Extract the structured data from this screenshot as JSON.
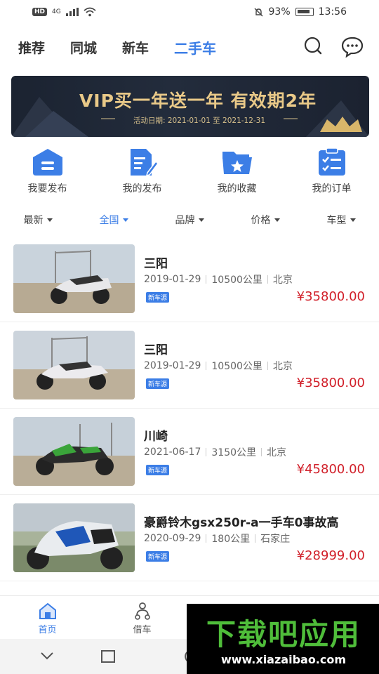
{
  "status_bar": {
    "network": "4G",
    "battery": "93%",
    "time": "13:56"
  },
  "top_tabs": [
    "推荐",
    "同城",
    "新车",
    "二手车"
  ],
  "active_tab": 3,
  "banner": {
    "title": "VIP买一年送一年 有效期2年",
    "date": "活动日期: 2021-01-01 至 2021-12-31"
  },
  "quick_actions": [
    {
      "label": "我要发布",
      "icon": "publish-icon"
    },
    {
      "label": "我的发布",
      "icon": "my-posts-icon"
    },
    {
      "label": "我的收藏",
      "icon": "favorites-folder-icon"
    },
    {
      "label": "我的订单",
      "icon": "orders-clipboard-icon"
    }
  ],
  "filters": [
    "最新",
    "全国",
    "品牌",
    "价格",
    "车型"
  ],
  "listings": [
    {
      "title": "三阳",
      "date": "2019-01-29",
      "mileage": "10500公里",
      "city": "北京",
      "badge": "新车源",
      "price": "¥35800.00"
    },
    {
      "title": "三阳",
      "date": "2019-01-29",
      "mileage": "10500公里",
      "city": "北京",
      "badge": "新车源",
      "price": "¥35800.00"
    },
    {
      "title": "川崎",
      "date": "2021-06-17",
      "mileage": "3150公里",
      "city": "北京",
      "badge": "新车源",
      "price": "¥45800.00"
    },
    {
      "title": "豪爵铃木gsx250r-a一手车0事故高",
      "date": "2020-09-29",
      "mileage": "180公里",
      "city": "石家庄",
      "badge": "新车源",
      "price": "¥28999.00"
    }
  ],
  "bottom_tabs": [
    "首页",
    "借车"
  ],
  "watermark": {
    "logo": "下载吧应用",
    "url": "www.xiazaibao.com"
  },
  "colors": {
    "accent": "#3c7ee6",
    "price": "#d1202a",
    "banner_gold": "#e9c988",
    "watermark_green": "#4fbd3a"
  }
}
